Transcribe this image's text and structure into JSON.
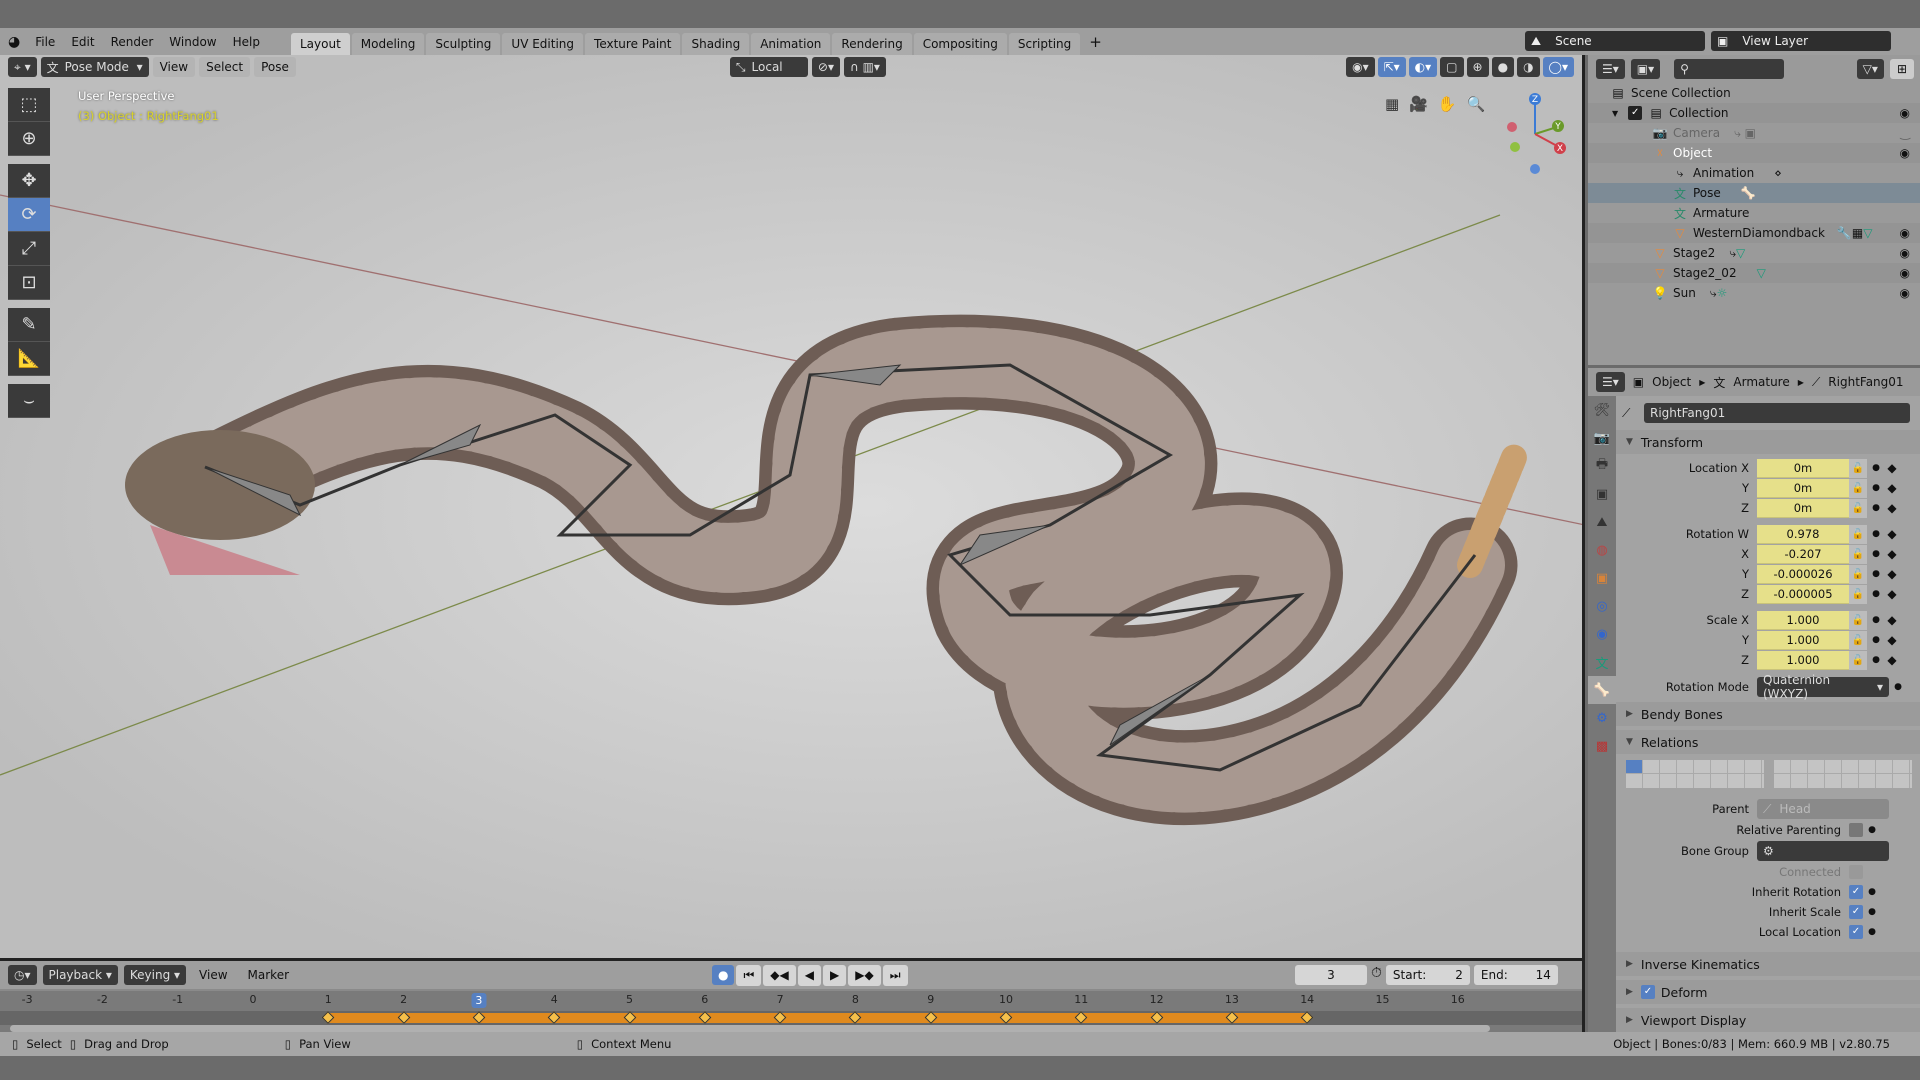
{
  "topbar": {
    "menus": [
      "File",
      "Edit",
      "Render",
      "Window",
      "Help"
    ],
    "workspaces": [
      "Layout",
      "Modeling",
      "Sculpting",
      "UV Editing",
      "Texture Paint",
      "Shading",
      "Animation",
      "Rendering",
      "Compositing",
      "Scripting"
    ],
    "active_workspace": "Layout",
    "scene": "Scene",
    "view_layer": "View Layer"
  },
  "viewport": {
    "mode": "Pose Mode",
    "menus": [
      "View",
      "Select",
      "Pose"
    ],
    "orientation": "Local",
    "overlay_title": "User Perspective",
    "overlay_info": "(3) Object : RightFang01",
    "gizmo_axes": [
      "X",
      "Y",
      "Z"
    ]
  },
  "timeline": {
    "menus": [
      "Playback",
      "Keying",
      "View",
      "Marker"
    ],
    "current_frame": "3",
    "start_label": "Start:",
    "start": "2",
    "end_label": "End:",
    "end": "14",
    "frames": [
      -3,
      -2,
      -1,
      0,
      1,
      2,
      3,
      4,
      5,
      6,
      7,
      8,
      9,
      10,
      11,
      12,
      13,
      14,
      15,
      16
    ],
    "keyframes": [
      1,
      2,
      3,
      4,
      5,
      6,
      7,
      8,
      9,
      10,
      11,
      12,
      13,
      14
    ]
  },
  "status": {
    "select": "Select",
    "drag": "Drag and Drop",
    "pan": "Pan View",
    "context": "Context Menu",
    "info": "Object | Bones:0/83  | Mem: 660.9 MB | v2.80.75"
  },
  "outliner": {
    "rows": [
      {
        "label": "Scene Collection"
      },
      {
        "label": "Collection"
      },
      {
        "label": "Camera"
      },
      {
        "label": "Object"
      },
      {
        "label": "Animation"
      },
      {
        "label": "Pose"
      },
      {
        "label": "Armature"
      },
      {
        "label": "WesternDiamondback"
      },
      {
        "label": "Stage2"
      },
      {
        "label": "Stage2_02"
      },
      {
        "label": "Sun"
      }
    ]
  },
  "properties": {
    "breadcrumb": [
      "Object",
      "Armature",
      "RightFang01"
    ],
    "bone_name": "RightFang01",
    "transform_label": "Transform",
    "location": {
      "label": "Location X",
      "x": "0m",
      "y": "0m",
      "z": "0m"
    },
    "rotation": {
      "label": "Rotation W",
      "w": "0.978",
      "x": "-0.207",
      "y": "-0.000026",
      "z": "-0.000005"
    },
    "scale": {
      "label": "Scale X",
      "x": "1.000",
      "y": "1.000",
      "z": "1.000"
    },
    "axis": {
      "x": "X",
      "y": "Y",
      "z": "Z"
    },
    "rotation_mode_label": "Rotation Mode",
    "rotation_mode": "Quaternion (WXYZ)",
    "bendy_bones": "Bendy Bones",
    "relations": "Relations",
    "parent_label": "Parent",
    "parent": "Head",
    "relative_parenting": "Relative Parenting",
    "bone_group_label": "Bone Group",
    "connected": "Connected",
    "inherit_rotation": "Inherit Rotation",
    "inherit_scale": "Inherit Scale",
    "local_location": "Local Location",
    "inverse_kinematics": "Inverse Kinematics",
    "deform": "Deform",
    "viewport_display": "Viewport Display"
  },
  "colors": {
    "accent": "#5680c2",
    "keyframe_bar": "#e08a1e",
    "field": "#e6e08a"
  }
}
